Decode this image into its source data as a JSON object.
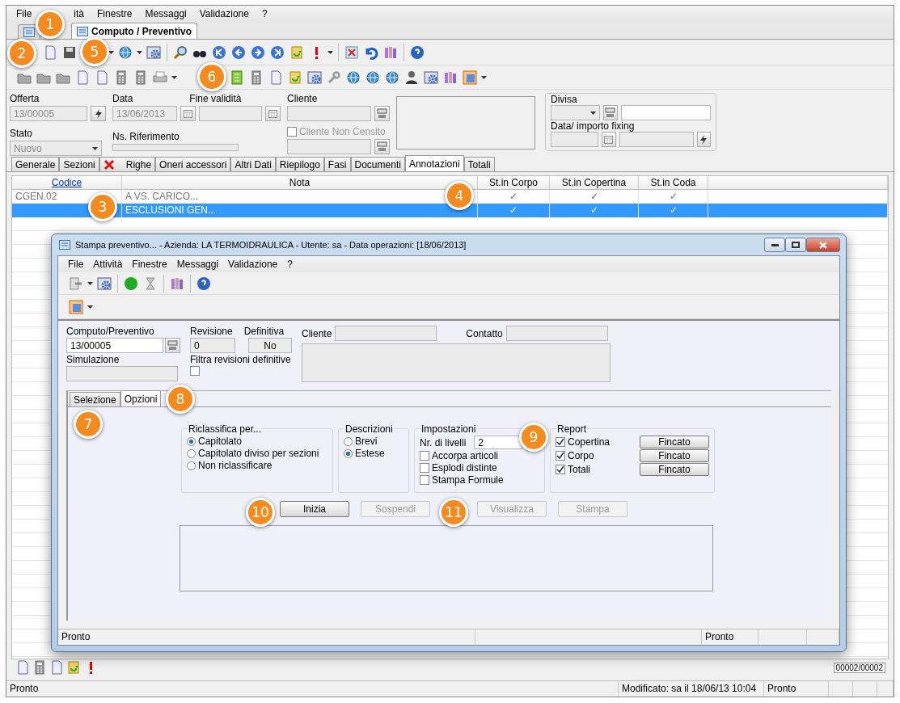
{
  "menu": [
    {
      "label": "File"
    },
    {
      "label": "ità"
    },
    {
      "label": "Finestre"
    },
    {
      "label": "Messaggi"
    },
    {
      "label": "Validazione"
    },
    {
      "label": "?"
    }
  ],
  "doc_tabs": [
    {
      "selected": false
    },
    {
      "label": "Computo / Preventivo",
      "selected": true
    }
  ],
  "header": {
    "offerta": {
      "label": "Offerta",
      "value": "13/00005"
    },
    "data": {
      "label": "Data",
      "value": "13/06/2013"
    },
    "fine_validita": {
      "label": "Fine validità"
    },
    "cliente": {
      "label": "Cliente"
    },
    "stato": {
      "label": "Stato",
      "value": "Nuovo"
    },
    "ns_riferimento": {
      "label": "Ns. Riferimento"
    },
    "cliente_non_censito": {
      "label": "Cliente Non Censito",
      "checked": false
    },
    "divisa": {
      "label": "Divisa"
    },
    "fixing": {
      "label": "Data/ importo fixing"
    }
  },
  "tabs": [
    {
      "label": "Generale",
      "selected": false,
      "flagged": false
    },
    {
      "label": "Sezioni",
      "selected": false,
      "flagged": false
    },
    {
      "label": "Righe",
      "selected": false,
      "flagged": true
    },
    {
      "label": "Oneri accessori",
      "selected": false,
      "flagged": false
    },
    {
      "label": "Altri Dati",
      "selected": false,
      "flagged": false
    },
    {
      "label": "Riepilogo",
      "selected": false,
      "flagged": false
    },
    {
      "label": "Fasi",
      "selected": false,
      "flagged": false
    },
    {
      "label": "Documenti",
      "selected": false,
      "flagged": false
    },
    {
      "label": "Annotazioni",
      "selected": true,
      "flagged": false
    },
    {
      "label": "Totali",
      "selected": false,
      "flagged": false
    }
  ],
  "grid": {
    "columns": [
      {
        "label": "Codice",
        "link": true
      },
      {
        "label": "Nota",
        "link": false
      },
      {
        "label": "St.in Corpo",
        "link": false
      },
      {
        "label": "St.in Copertina",
        "link": false
      },
      {
        "label": "St.in Coda",
        "link": false
      }
    ],
    "rows": [
      {
        "selected": false,
        "cells": [
          "CGEN.02",
          "A VS. CARICO...",
          "✓",
          "✓",
          "✓"
        ]
      },
      {
        "selected": true,
        "cells": [
          "",
          "ESCLUSIONI GEN...",
          "✓",
          "✓",
          "✓"
        ]
      }
    ]
  },
  "pager": "00002/00002",
  "status_bar": [
    "Pronto",
    "Modificato: sa il 18/06/13 10:04",
    "Pronto"
  ],
  "dialog": {
    "title": "Stampa preventivo... - Azienda: LA TERMOIDRAULICA - Utente: sa - Data operazioni: [18/06/2013]",
    "menu": [
      {
        "label": "File"
      },
      {
        "label": "Attività"
      },
      {
        "label": "Finestre"
      },
      {
        "label": "Messaggi"
      },
      {
        "label": "Validazione"
      },
      {
        "label": "?"
      }
    ],
    "computo": {
      "label": "Computo/Preventivo",
      "value": "13/00005"
    },
    "revisione": {
      "label": "Revisione",
      "value": "0"
    },
    "definitiva": {
      "label": "Definitiva",
      "value": "No"
    },
    "simulazione": {
      "label": "Simulazione"
    },
    "filtra": {
      "label": "Filtra revisioni definitive",
      "checked": false
    },
    "cliente": {
      "label": "Cliente"
    },
    "contatto": {
      "label": "Contatto"
    },
    "tabs": [
      {
        "label": "Selezione",
        "selected": false
      },
      {
        "label": "Opzioni",
        "selected": true
      }
    ],
    "riclassifica": {
      "title": "Riclassifica per...",
      "options": [
        {
          "label": "Capitolato",
          "selected": true
        },
        {
          "label": "Capitolato diviso per sezioni",
          "selected": false
        },
        {
          "label": "Non riclassificare",
          "selected": false
        }
      ]
    },
    "descrizioni": {
      "title": "Descrizioni",
      "options": [
        {
          "label": "Brevi",
          "selected": false
        },
        {
          "label": "Estese",
          "selected": true
        }
      ]
    },
    "impostazioni": {
      "title": "Impostazioni",
      "livelli_label": "Nr. di livelli",
      "livelli_value": "2",
      "checks": [
        {
          "label": "Accorpa articoli",
          "checked": false
        },
        {
          "label": "Esplodi distinte",
          "checked": false
        },
        {
          "label": "Stampa Formule",
          "checked": false
        }
      ]
    },
    "report": {
      "title": "Report",
      "items": [
        {
          "label": "Copertina",
          "checked": true,
          "button": "Fincato"
        },
        {
          "label": "Corpo",
          "checked": true,
          "button": "Fincato"
        },
        {
          "label": "Totali",
          "checked": true,
          "button": "Fincato"
        }
      ]
    },
    "buttons": [
      {
        "label": "Inizia",
        "disabled": false
      },
      {
        "label": "Sospendi",
        "disabled": true
      },
      {
        "label": "Visualizza",
        "disabled": true
      },
      {
        "label": "Stampa",
        "disabled": true
      }
    ],
    "status_bar": [
      "Pronto",
      "Pronto"
    ]
  },
  "callouts": [
    "1",
    "2",
    "3",
    "4",
    "5",
    "6",
    "7",
    "8",
    "9",
    "10",
    "11"
  ]
}
